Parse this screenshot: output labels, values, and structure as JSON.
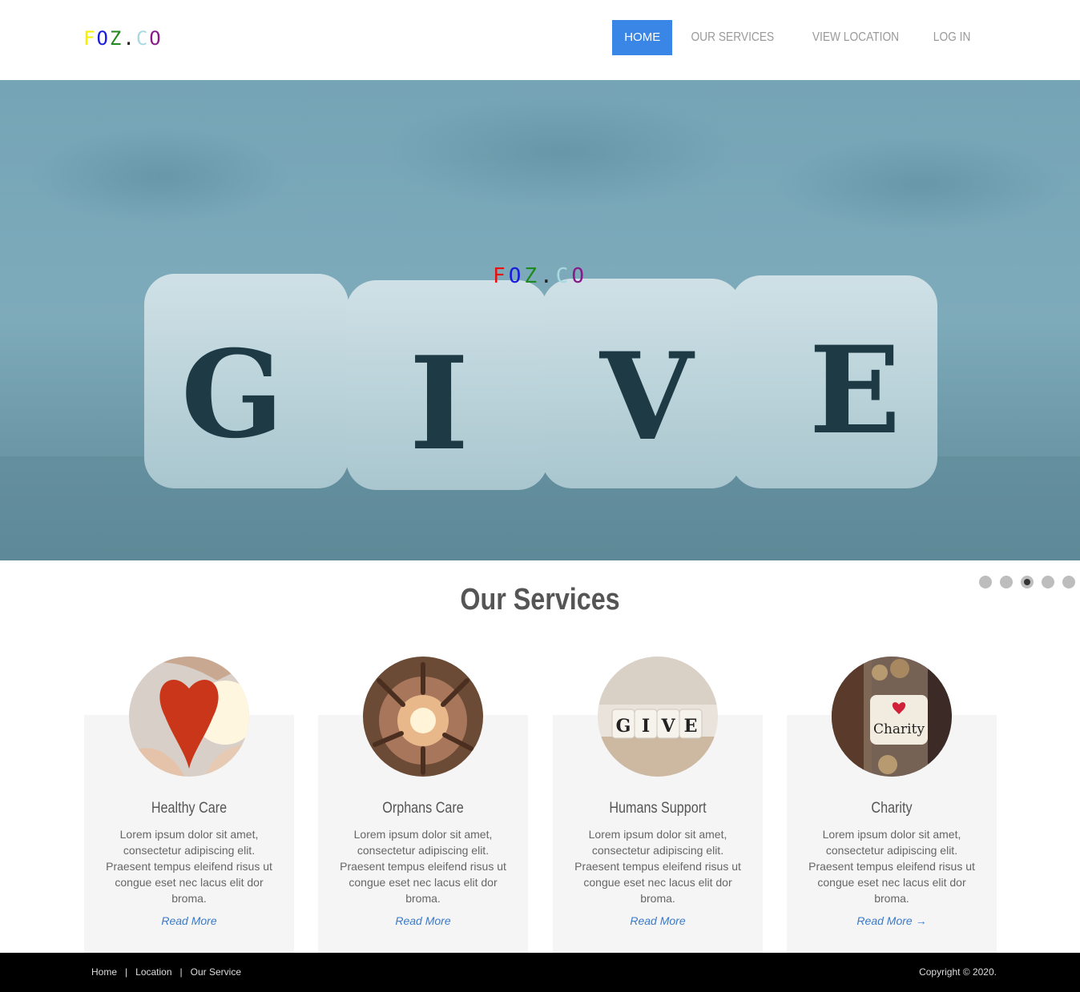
{
  "logo": {
    "letters": [
      {
        "char": "F",
        "color": "#f5f000"
      },
      {
        "char": "O",
        "color": "#1a1adf"
      },
      {
        "char": "Z",
        "color": "#1f8a1f"
      },
      {
        "char": ".",
        "color": "#222222"
      },
      {
        "char": "C",
        "color": "#a8d8e0"
      },
      {
        "char": "O",
        "color": "#8a1a8a"
      }
    ]
  },
  "hero_logo": {
    "letters": [
      {
        "char": "F",
        "color": "#e81010"
      },
      {
        "char": "O",
        "color": "#1a1adf"
      },
      {
        "char": "Z",
        "color": "#1f8a1f"
      },
      {
        "char": ".",
        "color": "#222222"
      },
      {
        "char": "C",
        "color": "#a8d8e0"
      },
      {
        "char": "O",
        "color": "#8a1a8a"
      }
    ]
  },
  "hero": {
    "dice_letters": [
      "G",
      "I",
      "V",
      "E"
    ],
    "carousel_active_index": 3,
    "carousel_count": 5
  },
  "nav": {
    "items": [
      {
        "label": "HOME",
        "active": true
      },
      {
        "label": "OUR SERVICES",
        "active": false
      },
      {
        "label": "VIEW LOCATION",
        "active": false
      },
      {
        "label": "LOG IN",
        "active": false
      }
    ]
  },
  "services": {
    "title": "Our Services",
    "cards": [
      {
        "title": "Healthy Care",
        "description": "Lorem ipsum dolor sit amet, consectetur adipiscing elit. Praesent tempus eleifend risus ut congue eset nec lacus elit dor broma.",
        "link": "Read More",
        "image": "heart-hands-image"
      },
      {
        "title": "Orphans Care",
        "description": "Lorem ipsum dolor sit amet, consectetur adipiscing elit. Praesent tempus eleifend risus ut congue eset nec lacus elit dor broma.",
        "link": "Read More",
        "image": "hands-light-image"
      },
      {
        "title": "Humans Support",
        "description": "Lorem ipsum dolor sit amet, consectetur adipiscing elit. Praesent tempus eleifend risus ut congue eset nec lacus elit dor broma.",
        "link": "Read More",
        "image": "give-dice-image"
      },
      {
        "title": "Charity",
        "description": "Lorem ipsum dolor sit amet, consectetur adipiscing elit. Praesent tempus eleifend risus ut congue eset nec lacus elit dor broma.",
        "link": "Read More →",
        "image": "charity-jar-image"
      }
    ]
  },
  "footer": {
    "links": [
      "Home",
      "Location",
      "Our Service"
    ],
    "separator": "|",
    "copyright": "Copyright © 2020."
  },
  "colors": {
    "accent": "#3a86e6",
    "link": "#3a7ac8",
    "card_bg": "#f5f5f5",
    "footer_bg": "#000000"
  }
}
